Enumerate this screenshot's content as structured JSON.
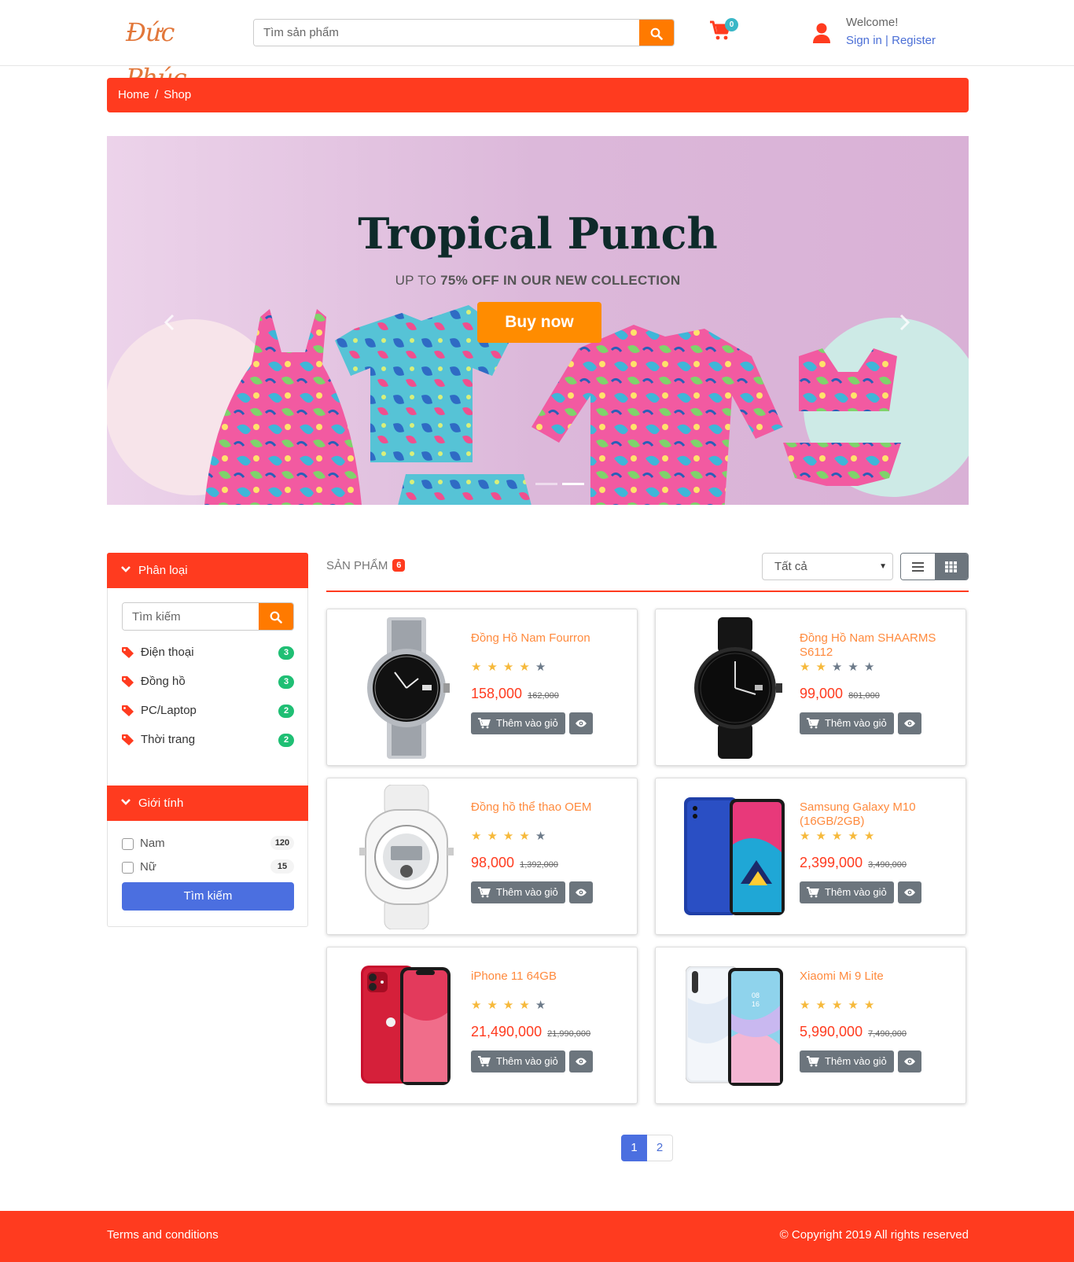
{
  "header": {
    "logo_text": "Đức Phúc",
    "search_placeholder": "Tìm sản phẩm",
    "cart_count": "0",
    "welcome": "Welcome!",
    "sign_in": "Sign in",
    "separator": "|",
    "register": "Register"
  },
  "breadcrumb": {
    "home": "Home",
    "separator": "/",
    "current": "Shop"
  },
  "banner": {
    "title": "Tropical Punch",
    "subtitle_prefix": "UP TO ",
    "subtitle_bold": "75% OFF IN OUR NEW COLLECTION",
    "button": "Buy now",
    "active_slide": 2,
    "slide_count": 2
  },
  "sidebar": {
    "category_title": "Phân loại",
    "search_placeholder": "Tìm kiếm",
    "categories": [
      {
        "label": "Điện thoại",
        "count": "3"
      },
      {
        "label": "Đồng hồ",
        "count": "3"
      },
      {
        "label": "PC/Laptop",
        "count": "2"
      },
      {
        "label": "Thời trang",
        "count": "2"
      }
    ],
    "gender_title": "Giới tính",
    "genders": [
      {
        "label": "Nam",
        "count": "120"
      },
      {
        "label": "Nữ",
        "count": "15"
      }
    ],
    "submit": "Tìm kiếm"
  },
  "products_header": {
    "title": "SẢN PHẨM",
    "count": "6",
    "sort_selected": "Tất cả"
  },
  "colors": {
    "brand_red": "#ff3b1f",
    "accent_orange": "#ff7a00",
    "product_name": "#ff8a3d",
    "primary_blue": "#4b6fe0",
    "star": "#f6b93b"
  },
  "products": [
    {
      "name": "Đồng Hồ Nam Fourron",
      "rating": 4,
      "price": "158,000",
      "old_price": "162,000",
      "add_label": "Thêm vào giỏ",
      "image": "silver-watch"
    },
    {
      "name": "Đồng Hồ Nam SHAARMS S6112",
      "rating": 2,
      "price": "99,000",
      "old_price": "801,000",
      "add_label": "Thêm vào giỏ",
      "image": "black-watch"
    },
    {
      "name": "Đồng hồ thể thao OEM",
      "rating": 4,
      "price": "98,000",
      "old_price": "1,392,000",
      "add_label": "Thêm vào giỏ",
      "image": "white-sport-watch"
    },
    {
      "name": "Samsung Galaxy M10 (16GB/2GB)",
      "rating": 5,
      "price": "2,399,000",
      "old_price": "3,490,000",
      "add_label": "Thêm vào giỏ",
      "image": "blue-phone"
    },
    {
      "name": "iPhone 11 64GB",
      "rating": 4,
      "price": "21,490,000",
      "old_price": "21,990,000",
      "add_label": "Thêm vào giỏ",
      "image": "red-iphone"
    },
    {
      "name": "Xiaomi Mi 9 Lite",
      "rating": 5,
      "price": "5,990,000",
      "old_price": "7,490,000",
      "add_label": "Thêm vào giỏ",
      "image": "white-phone"
    }
  ],
  "pagination": {
    "pages": [
      "1",
      "2"
    ],
    "current": "1"
  },
  "footer": {
    "terms": "Terms and conditions",
    "copyright": "© Copyright 2019 All rights reserved"
  }
}
